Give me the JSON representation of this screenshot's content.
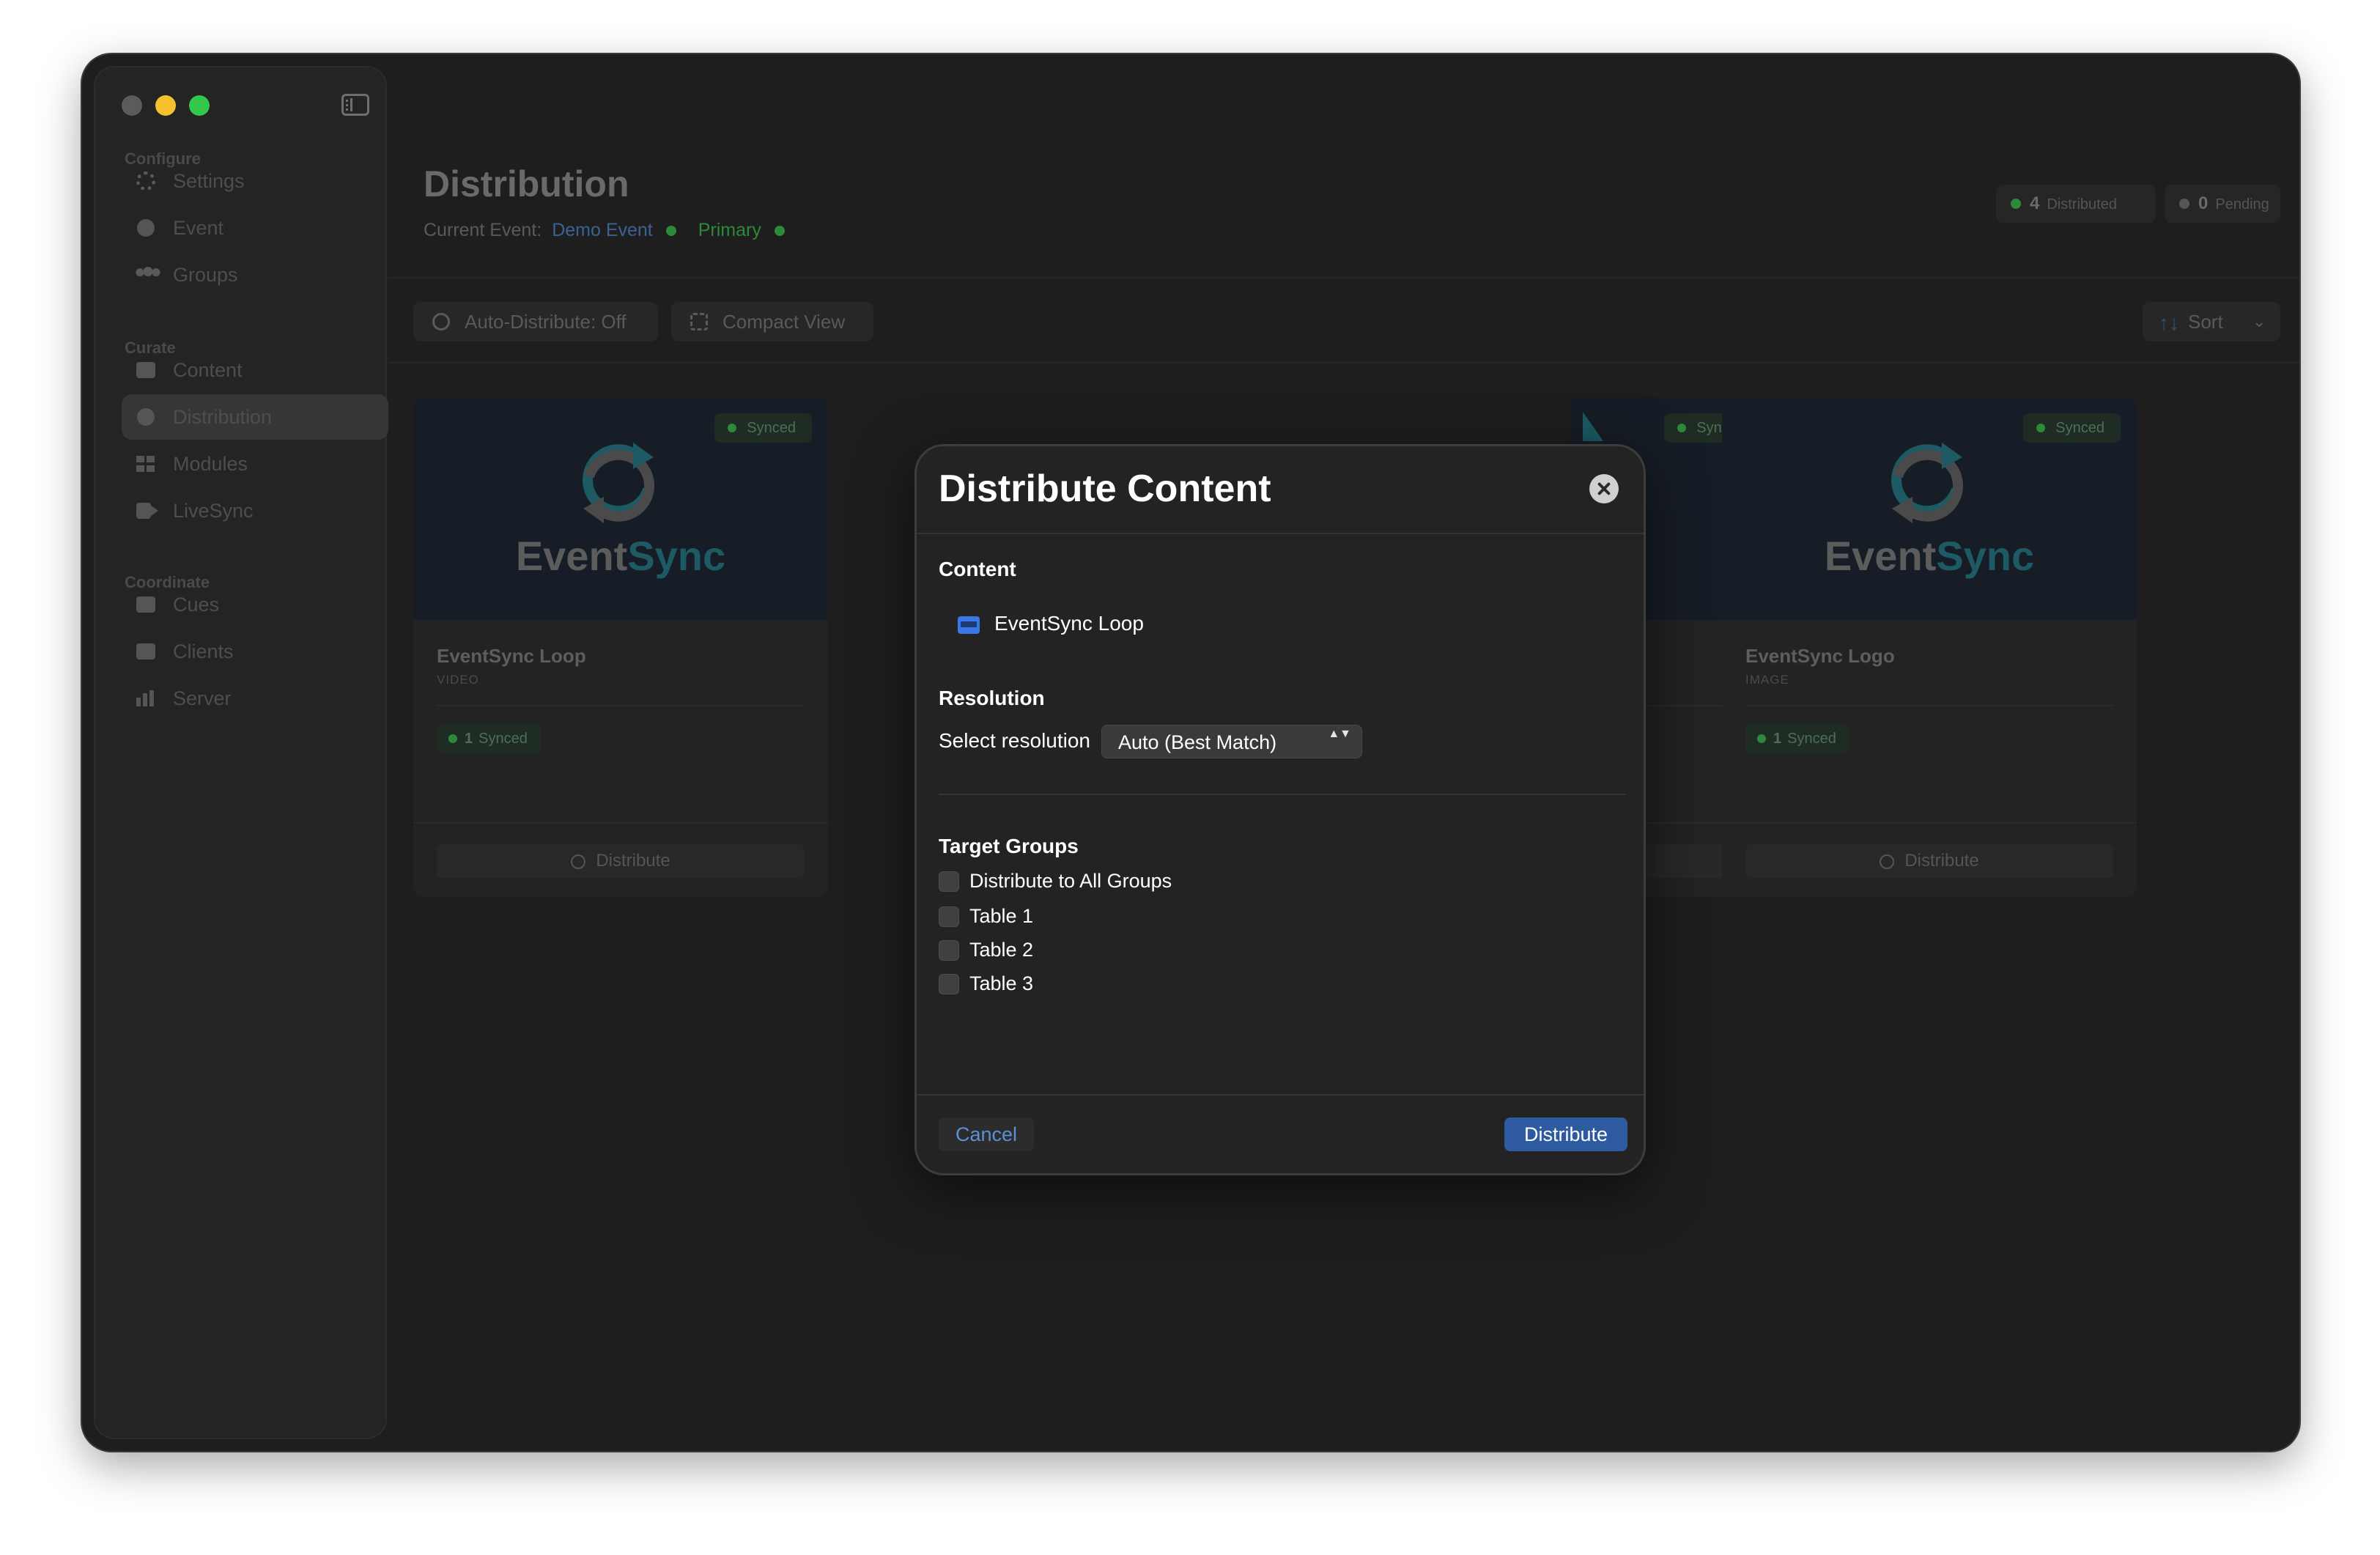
{
  "sidebar": {
    "sections": [
      {
        "header": "Configure",
        "items": [
          {
            "label": "Settings",
            "icon": "gear-icon"
          },
          {
            "label": "Event",
            "icon": "event-icon"
          },
          {
            "label": "Groups",
            "icon": "groups-icon"
          }
        ]
      },
      {
        "header": "Curate",
        "items": [
          {
            "label": "Content",
            "icon": "content-icon"
          },
          {
            "label": "Distribution",
            "icon": "distribution-icon",
            "active": true
          },
          {
            "label": "Modules",
            "icon": "modules-icon"
          },
          {
            "label": "LiveSync",
            "icon": "camera-icon"
          }
        ]
      },
      {
        "header": "Coordinate",
        "items": [
          {
            "label": "Cues",
            "icon": "cues-icon"
          },
          {
            "label": "Clients",
            "icon": "clients-icon"
          },
          {
            "label": "Server",
            "icon": "server-icon"
          }
        ]
      }
    ]
  },
  "header": {
    "title": "Distribution",
    "current_event_label": "Current Event:",
    "event_name": "Demo Event",
    "role": "Primary",
    "stats": {
      "distributed_count": "4",
      "distributed_label": "Distributed",
      "pending_count": "0",
      "pending_label": "Pending"
    }
  },
  "toolbar": {
    "auto_distribute": "Auto-Distribute: Off",
    "compact_view": "Compact View",
    "sort": "Sort",
    "sort_arrows": "↑↓",
    "sort_chevron": "⌄"
  },
  "cards": [
    {
      "badge": "Synced",
      "logo_word1": "Event",
      "logo_word2": "Sync",
      "title": "EventSync Loop",
      "type": "VIDEO",
      "synced_count": "1",
      "synced_label": "Synced",
      "action": "Distribute"
    },
    {
      "badge": "Synced"
    },
    {
      "badge": "Synced",
      "logo_word1": "Event",
      "logo_word2": "Sync",
      "title": "EventSync Logo",
      "type": "IMAGE",
      "synced_count": "1",
      "synced_label": "Synced",
      "action": "Distribute"
    }
  ],
  "modal": {
    "title": "Distribute Content",
    "content_label": "Content",
    "content_item": "EventSync Loop",
    "resolution_label": "Resolution",
    "select_label": "Select resolution",
    "select_value": "Auto (Best Match)",
    "select_arrows": "▲▼",
    "target_label": "Target Groups",
    "groups": [
      "Distribute to All Groups",
      "Table 1",
      "Table 2",
      "Table 3"
    ],
    "cancel": "Cancel",
    "distribute": "Distribute"
  },
  "colors": {
    "accent": "#2e5aa0",
    "link": "#5b8fd6",
    "status_green": "#2c8a3a",
    "teal": "#1d5a63"
  }
}
